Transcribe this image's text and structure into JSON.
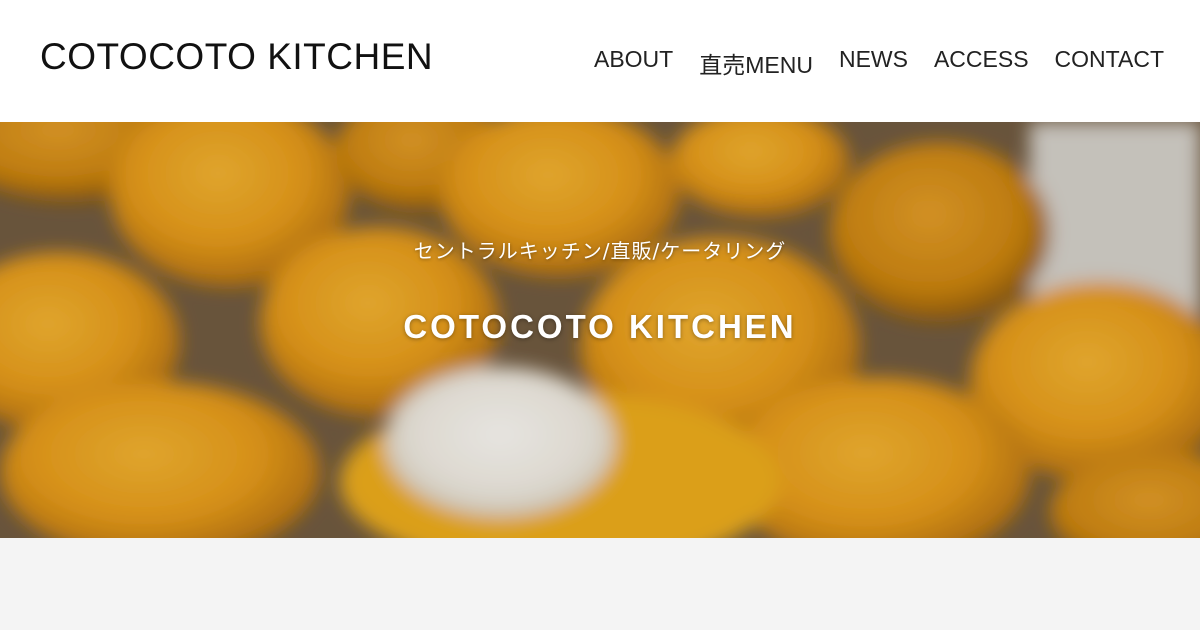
{
  "header": {
    "logo_text": "COTOCOTO KITCHEN",
    "nav": [
      {
        "label": "ABOUT"
      },
      {
        "label": "直売MENU"
      },
      {
        "label": "NEWS"
      },
      {
        "label": "ACCESS"
      },
      {
        "label": "CONTACT"
      }
    ]
  },
  "hero": {
    "subtitle": "セントラルキッチン/直販/ケータリング",
    "title": "COTOCOTO KITCHEN"
  },
  "colors": {
    "header_bg": "#ffffff",
    "hero_orange": "#e9a21c",
    "footer_band": "#f4f4f4",
    "hero_text": "#ffffff"
  },
  "icons": {}
}
